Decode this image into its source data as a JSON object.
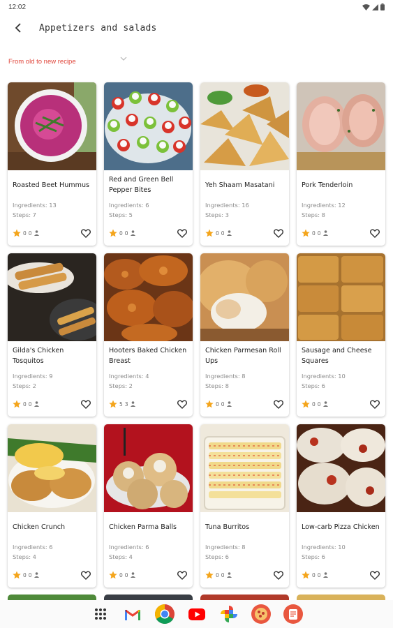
{
  "status_bar": {
    "time": "12:02"
  },
  "header": {
    "title": "Appetizers and salads"
  },
  "sort": {
    "selected": "From old to new recipe"
  },
  "colors": {
    "accent": "#e0453a",
    "star": "#f4a51c"
  },
  "recipes": [
    {
      "title": "Roasted Beet Hummus",
      "ingredients": "Ingredients: 13",
      "steps": "Steps: 7",
      "rating": "0",
      "users": "0"
    },
    {
      "title": "Red and Green Bell Pepper Bites",
      "ingredients": "Ingredients: 6",
      "steps": "Steps: 5",
      "rating": "0",
      "users": "0"
    },
    {
      "title": "Yeh Shaam Masatani",
      "ingredients": "Ingredients: 16",
      "steps": "Steps: 3",
      "rating": "0",
      "users": "0"
    },
    {
      "title": "Pork Tenderloin",
      "ingredients": "Ingredients: 12",
      "steps": "Steps: 8",
      "rating": "0",
      "users": "0"
    },
    {
      "title": "Gilda's Chicken Tosquitos",
      "ingredients": "Ingredients: 9",
      "steps": "Steps: 2",
      "rating": "0",
      "users": "0"
    },
    {
      "title": "Hooters Baked Chicken Breast",
      "ingredients": "Ingredients: 4",
      "steps": "Steps: 2",
      "rating": "5",
      "users": "3"
    },
    {
      "title": "Chicken Parmesan Roll Ups",
      "ingredients": "Ingredients: 8",
      "steps": "Steps: 8",
      "rating": "0",
      "users": "0"
    },
    {
      "title": "Sausage and Cheese Squares",
      "ingredients": "Ingredients: 10",
      "steps": "Steps: 6",
      "rating": "0",
      "users": "0"
    },
    {
      "title": "Chicken Crunch",
      "ingredients": "Ingredients: 6",
      "steps": "Steps: 4",
      "rating": "0",
      "users": "0"
    },
    {
      "title": "Chicken Parma Balls",
      "ingredients": "Ingredients: 6",
      "steps": "Steps: 4",
      "rating": "0",
      "users": "0"
    },
    {
      "title": "Tuna Burritos",
      "ingredients": "Ingredients: 8",
      "steps": "Steps: 6",
      "rating": "0",
      "users": "0"
    },
    {
      "title": "Low-carb Pizza Chicken",
      "ingredients": "Ingredients: 10",
      "steps": "Steps: 6",
      "rating": "0",
      "users": "0"
    }
  ],
  "taskbar": {
    "items": [
      "app-drawer-icon",
      "gmail-icon",
      "chrome-icon",
      "youtube-icon",
      "photos-icon",
      "pizza-recipes-app-icon",
      "recipe-book-app-icon"
    ]
  }
}
